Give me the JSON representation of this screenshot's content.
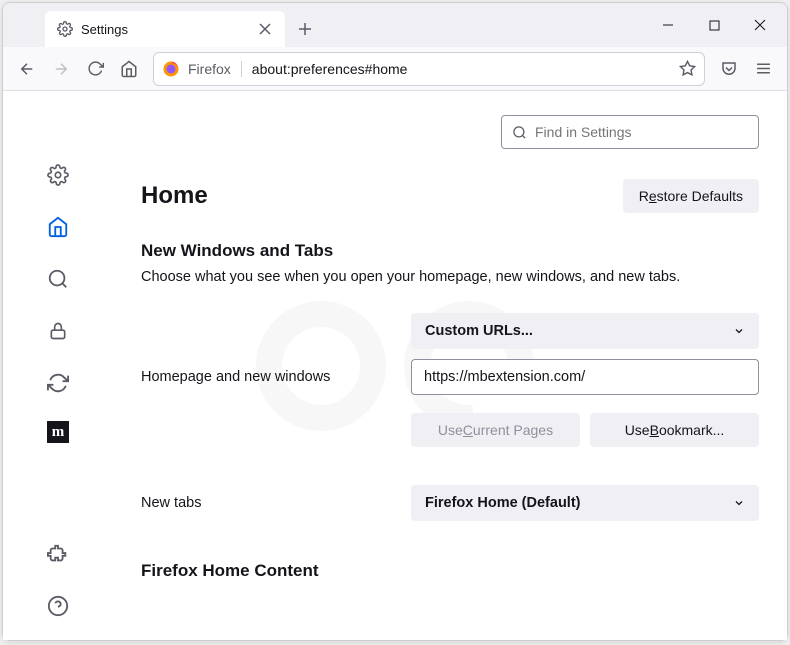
{
  "tab": {
    "title": "Settings"
  },
  "urlbar": {
    "label": "Firefox",
    "text": "about:preferences#home"
  },
  "search": {
    "placeholder": "Find in Settings"
  },
  "heading": "Home",
  "restore_btn": {
    "pre": "R",
    "u": "e",
    "post": "store Defaults"
  },
  "section": {
    "title": "New Windows and Tabs",
    "desc": "Choose what you see when you open your homepage, new windows, and new tabs."
  },
  "homepage": {
    "label": "Homepage and new windows",
    "select": "Custom URLs...",
    "value": "https://mbextension.com/",
    "use_current": {
      "pre": "Use ",
      "u": "C",
      "post": "urrent Pages"
    },
    "use_bookmark": {
      "pre": "Use ",
      "u": "B",
      "post": "ookmark..."
    }
  },
  "newtabs": {
    "label": "New tabs",
    "select": "Firefox Home (Default)"
  },
  "section2": "Firefox Home Content"
}
